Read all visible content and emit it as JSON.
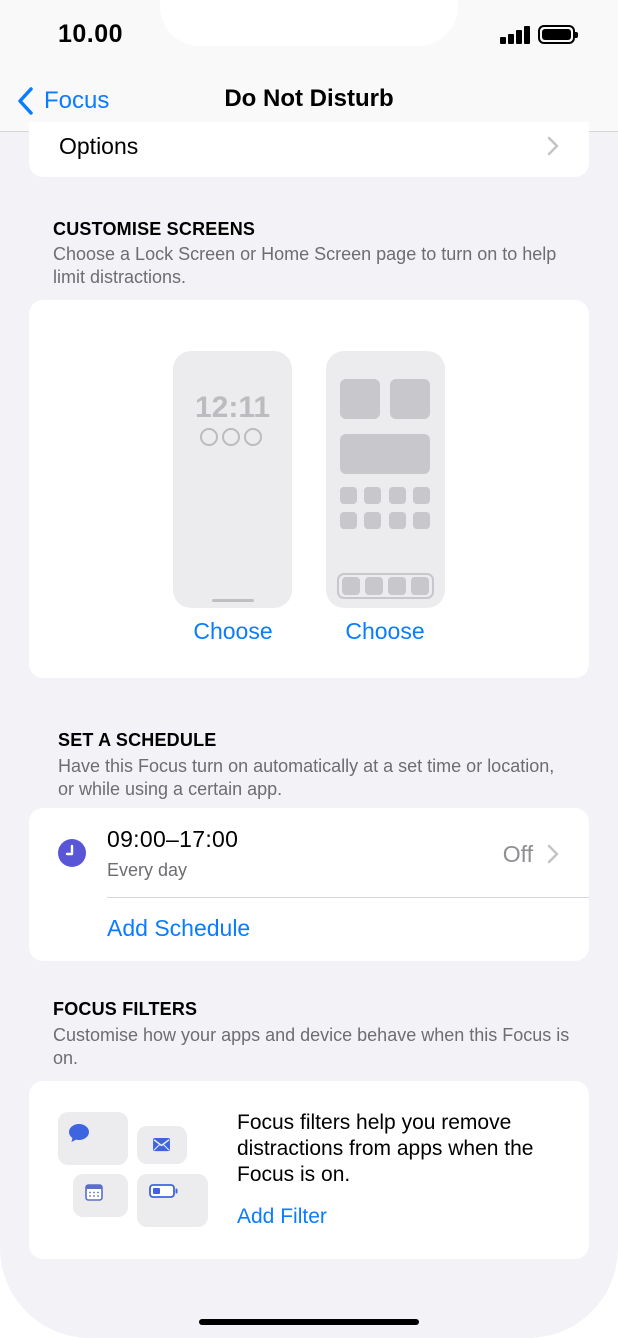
{
  "status_bar": {
    "time": "10.00"
  },
  "nav": {
    "back_label": "Focus",
    "title": "Do Not Disturb"
  },
  "options_row": {
    "label": "Options"
  },
  "customise": {
    "header": "CUSTOMISE SCREENS",
    "description": "Choose a Lock Screen or Home Screen page to turn on to help limit distractions.",
    "lock_preview_time": "12:11",
    "lock_choose_label": "Choose",
    "home_choose_label": "Choose"
  },
  "schedule": {
    "header": "SET A SCHEDULE",
    "description": "Have this Focus turn on automatically at a set time or location, or while using a certain app.",
    "time_range": "09:00–17:00",
    "recurrence": "Every day",
    "state": "Off",
    "add_label": "Add Schedule"
  },
  "filters": {
    "header": "FOCUS FILTERS",
    "description": "Customise how your apps and device behave when this Focus is on.",
    "info_text": "Focus filters help you remove distractions from apps when the Focus is on.",
    "add_label": "Add Filter"
  },
  "colors": {
    "accent": "#0a7cff",
    "clock_icon": "#5856d6",
    "background": "#f2f2f7",
    "secondary_text": "#6d6d72"
  },
  "icons": [
    "chevron-left-icon",
    "chevron-right-icon",
    "clock-icon",
    "message-bubble-icon",
    "mail-icon",
    "calendar-icon",
    "battery-icon",
    "signal-icon"
  ]
}
